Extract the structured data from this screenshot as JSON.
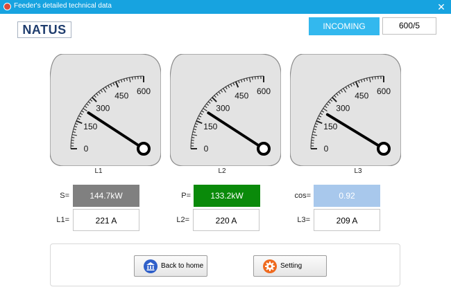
{
  "window": {
    "title": "Feeder's detailed technical data",
    "close_glyph": "✕"
  },
  "logo": {
    "text": "NATUS"
  },
  "header": {
    "incoming_label": "INCOMING",
    "ratio": "600/5"
  },
  "gauges": [
    {
      "label": "L1",
      "value": 221
    },
    {
      "label": "L2",
      "value": 220
    },
    {
      "label": "L3",
      "value": 209
    }
  ],
  "gauge_scale": {
    "min": 0,
    "max": 600,
    "ticks": [
      "0",
      "150",
      "300",
      "450",
      "600"
    ]
  },
  "measurements": {
    "s_label": "S=",
    "s_value": "144.7kW",
    "p_label": "P=",
    "p_value": "133.2kW",
    "cos_label": "cos=",
    "cos_value": "0.92",
    "l1_label": "L1=",
    "l1_value": "221 A",
    "l2_label": "L2=",
    "l2_value": "220 A",
    "l3_label": "L3=",
    "l3_value": "209 A"
  },
  "buttons": {
    "home_label": "Back to home",
    "home_icon": "bank-icon",
    "setting_label": "Setting",
    "setting_icon": "gear-icon"
  },
  "colors": {
    "titlebar": "#17a3e0",
    "incoming": "#33b8ee",
    "s_box": "#808080",
    "p_box": "#0a8a0a",
    "cos_box": "#a8c8ec"
  }
}
